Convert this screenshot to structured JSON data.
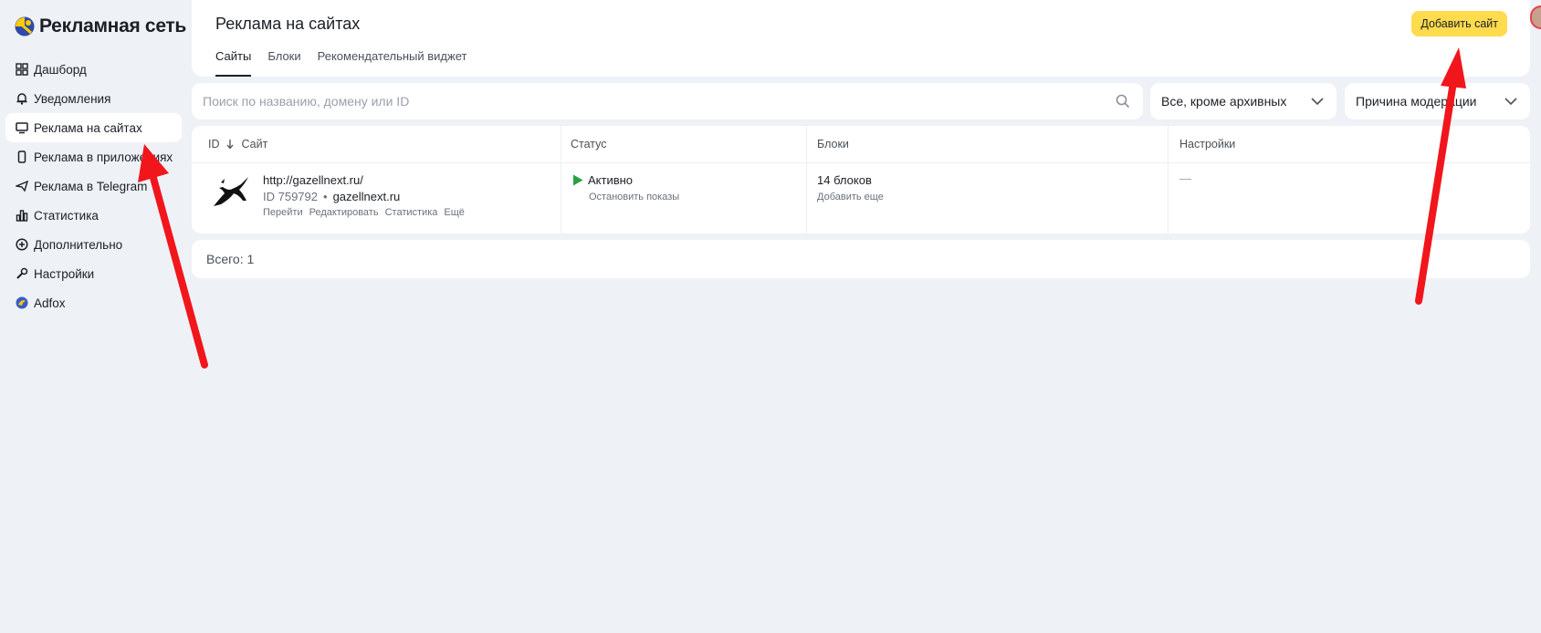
{
  "brand": {
    "name": "Рекламная сеть"
  },
  "sidebar": {
    "items": [
      {
        "label": "Дашборд",
        "icon": "grid-icon",
        "active": false
      },
      {
        "label": "Уведомления",
        "icon": "bell-icon",
        "active": false
      },
      {
        "label": "Реклама на сайтах",
        "icon": "monitor-icon",
        "active": true
      },
      {
        "label": "Реклама в приложениях",
        "icon": "phone-icon",
        "active": false
      },
      {
        "label": "Реклама в Telegram",
        "icon": "paper-plane-icon",
        "active": false
      },
      {
        "label": "Статистика",
        "icon": "bar-chart-icon",
        "active": false
      },
      {
        "label": "Дополнительно",
        "icon": "plus-circle-icon",
        "active": false
      },
      {
        "label": "Настройки",
        "icon": "wrench-icon",
        "active": false
      },
      {
        "label": "Adfox",
        "icon": "adfox-logo-icon",
        "active": false
      }
    ]
  },
  "header": {
    "title": "Реклама на сайтах",
    "tabs": [
      {
        "label": "Сайты",
        "active": true
      },
      {
        "label": "Блоки",
        "active": false
      },
      {
        "label": "Рекомендательный виджет",
        "active": false
      }
    ],
    "add_button": "Добавить сайт"
  },
  "filters": {
    "search_placeholder": "Поиск по названию, домену или ID",
    "status_select": "Все, кроме архивных",
    "reason_select": "Причина модерации"
  },
  "table": {
    "columns": {
      "id": "ID",
      "site": "Сайт",
      "status": "Статус",
      "blocks": "Блоки",
      "settings": "Настройки"
    },
    "rows": [
      {
        "url": "http://gazellnext.ru/",
        "id_label": "ID 759792",
        "separator": "•",
        "domain": "gazellnext.ru",
        "actions": [
          "Перейти",
          "Редактировать",
          "Статистика",
          "Ещё"
        ],
        "status": "Активно",
        "status_action": "Остановить показы",
        "blocks": "14 блоков",
        "blocks_action": "Добавить еще",
        "settings": "—"
      }
    ]
  },
  "footer": {
    "total": "Всего: 1"
  },
  "colors": {
    "accent": "#ffdb4d",
    "status_active": "#2ba243",
    "annotation_arrow": "#f0161c",
    "background": "#eef1f6"
  }
}
